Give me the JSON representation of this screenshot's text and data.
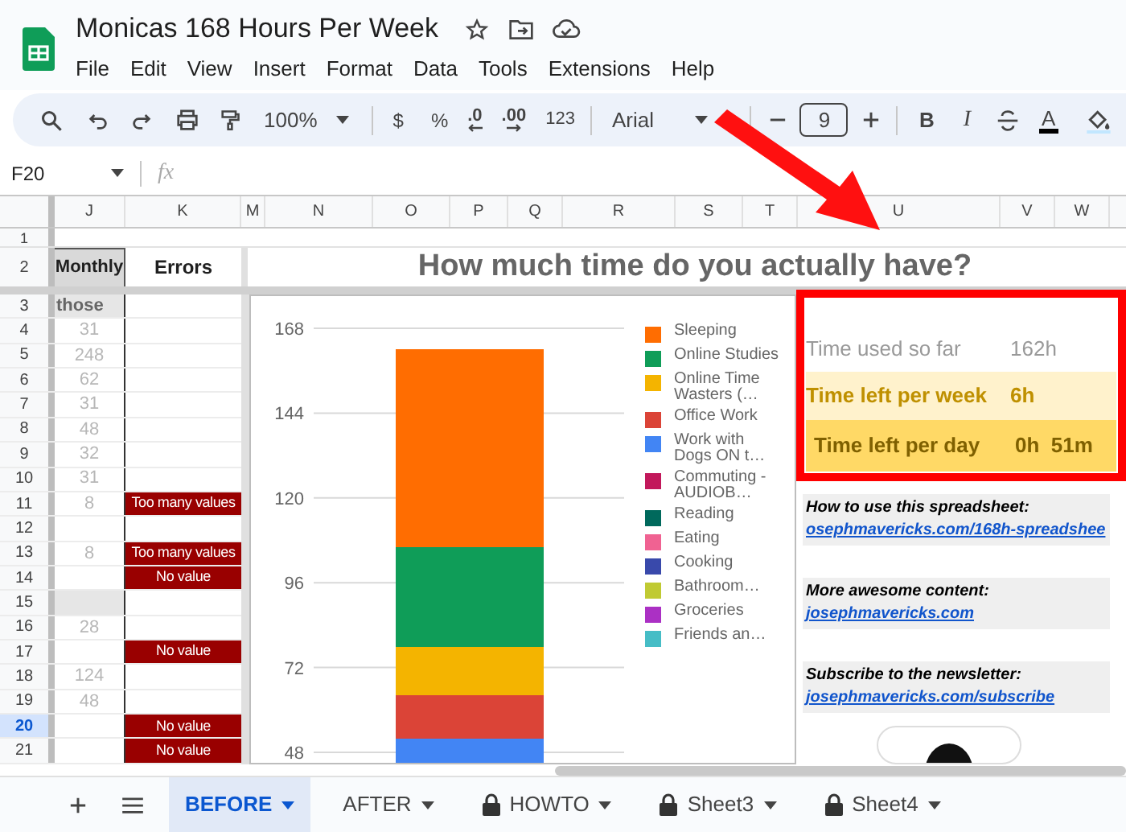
{
  "document": {
    "title": "Monicas 168 Hours Per Week"
  },
  "menu": [
    "File",
    "Edit",
    "View",
    "Insert",
    "Format",
    "Data",
    "Tools",
    "Extensions",
    "Help"
  ],
  "toolbar": {
    "zoom": "100%",
    "currency": "$",
    "percent": "%",
    "decrease_decimal": ".0",
    "increase_decimal": ".00",
    "number_format": "123",
    "font": "Arial",
    "font_size": "9",
    "bold": "B",
    "italic": "I",
    "text_color": "A"
  },
  "formula_bar": {
    "cell": "F20",
    "fx": "fx"
  },
  "columns": [
    "J",
    "K",
    "M",
    "N",
    "O",
    "P",
    "Q",
    "R",
    "S",
    "T",
    "U",
    "V",
    "W"
  ],
  "header_rows": [
    {
      "number": "1"
    },
    {
      "number": "2",
      "monthly": "Monthly",
      "errors": "Errors",
      "title": "How much time do you actually have?"
    }
  ],
  "rows": [
    {
      "number": "3",
      "kind": "label",
      "monthly": "those",
      "error": "",
      "shaded": true,
      "selected": false
    },
    {
      "number": "4",
      "kind": "value",
      "monthly": "31",
      "error": "",
      "shaded": false,
      "selected": false
    },
    {
      "number": "5",
      "kind": "value",
      "monthly": "248",
      "error": "",
      "shaded": false,
      "selected": false
    },
    {
      "number": "6",
      "kind": "value",
      "monthly": "62",
      "error": "",
      "shaded": false,
      "selected": false
    },
    {
      "number": "7",
      "kind": "value",
      "monthly": "31",
      "error": "",
      "shaded": false,
      "selected": false
    },
    {
      "number": "8",
      "kind": "value",
      "monthly": "48",
      "error": "",
      "shaded": false,
      "selected": false
    },
    {
      "number": "9",
      "kind": "value",
      "monthly": "32",
      "error": "",
      "shaded": false,
      "selected": false
    },
    {
      "number": "10",
      "kind": "value",
      "monthly": "31",
      "error": "",
      "shaded": false,
      "selected": false
    },
    {
      "number": "11",
      "kind": "value",
      "monthly": "8",
      "error": "Too many values",
      "shaded": false,
      "selected": false
    },
    {
      "number": "12",
      "kind": "value",
      "monthly": "",
      "error": "",
      "shaded": false,
      "selected": false
    },
    {
      "number": "13",
      "kind": "value",
      "monthly": "8",
      "error": "Too many values",
      "shaded": false,
      "selected": false
    },
    {
      "number": "14",
      "kind": "value",
      "monthly": "",
      "error": "No value",
      "shaded": false,
      "selected": false
    },
    {
      "number": "15",
      "kind": "value",
      "monthly": "",
      "error": "",
      "shaded": true,
      "selected": false
    },
    {
      "number": "16",
      "kind": "value",
      "monthly": "28",
      "error": "",
      "shaded": false,
      "selected": false
    },
    {
      "number": "17",
      "kind": "value",
      "monthly": "",
      "error": "No value",
      "shaded": false,
      "selected": false
    },
    {
      "number": "18",
      "kind": "value",
      "monthly": "124",
      "error": "",
      "shaded": false,
      "selected": false
    },
    {
      "number": "19",
      "kind": "value",
      "monthly": "48",
      "error": "",
      "shaded": false,
      "selected": false
    },
    {
      "number": "20",
      "kind": "value",
      "monthly": "",
      "error": "No value",
      "shaded": false,
      "selected": true
    },
    {
      "number": "21",
      "kind": "value",
      "monthly": "",
      "error": "No value",
      "shaded": false,
      "selected": false
    }
  ],
  "chart": {
    "axis_labels": [
      "168",
      "144",
      "120",
      "96",
      "72",
      "48"
    ],
    "legend": [
      {
        "name": "Sleeping",
        "color": "#ff6d01"
      },
      {
        "name": "Online Studies",
        "color": "#0f9d58"
      },
      {
        "name": "Online Time Wasters (…",
        "color": "#f4b400"
      },
      {
        "name": "Office Work",
        "color": "#db4437"
      },
      {
        "name": "Work with Dogs ON t…",
        "color": "#4285f4"
      },
      {
        "name": "Commuting - AUDIOB…",
        "color": "#c2185b"
      },
      {
        "name": "Reading",
        "color": "#00695c"
      },
      {
        "name": "Eating",
        "color": "#f06292"
      },
      {
        "name": "Cooking",
        "color": "#3949ab"
      },
      {
        "name": "Bathroom…",
        "color": "#c0ca33"
      },
      {
        "name": "Groceries",
        "color": "#ab30c4"
      },
      {
        "name": "Friends an…",
        "color": "#46bdc6"
      }
    ]
  },
  "summary": [
    {
      "kind": "used",
      "label": "Time used so far",
      "value": "162h"
    },
    {
      "kind": "week",
      "label": "Time left per week",
      "value": "6h"
    },
    {
      "kind": "day",
      "label": "Time left per day",
      "value": "0h  51m"
    }
  ],
  "links": [
    {
      "heading": "How to use this spreadsheet:",
      "link": "osephmavericks.com/168h-spreadshee"
    },
    {
      "heading": "More awesome content:",
      "link": "josephmavericks.com"
    },
    {
      "heading": "Subscribe to the newsletter:",
      "link": "josephmavericks.com/subscribe"
    }
  ],
  "sheet_tabs": [
    {
      "label": "BEFORE",
      "selected": true,
      "locked": false
    },
    {
      "label": "AFTER",
      "selected": false,
      "locked": false
    },
    {
      "label": "HOWTO",
      "selected": false,
      "locked": true
    },
    {
      "label": "Sheet3",
      "selected": false,
      "locked": true
    },
    {
      "label": "Sheet4",
      "selected": false,
      "locked": true
    }
  ]
}
